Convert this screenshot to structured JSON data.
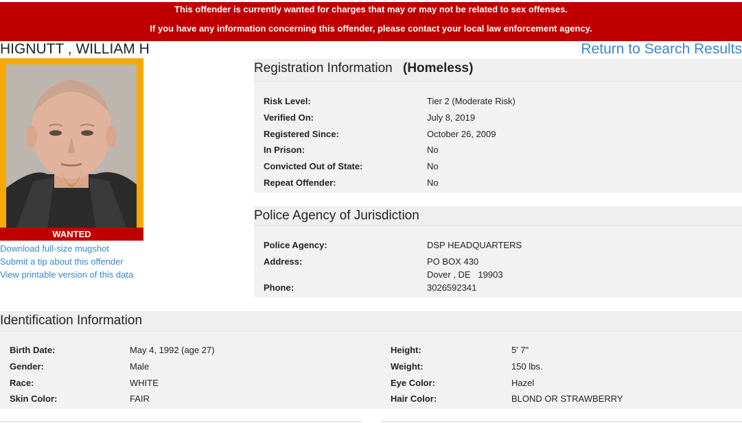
{
  "banner": {
    "line1": "This offender is currently wanted for charges that may or may not be related to sex offenses.",
    "line2": "If you have any information concerning this offender, please contact your local law enforcement agency."
  },
  "offender": {
    "name": "HIGNUTT , WILLIAM H"
  },
  "nav": {
    "return_label": "Return to Search Results"
  },
  "photo": {
    "badge": "WANTED",
    "frame_color": "#f7a800"
  },
  "links": [
    "Download full-size mugshot",
    "Submit a tip about this offender",
    "View printable version of this data"
  ],
  "registration": {
    "title": "Registration Information",
    "status": "(Homeless)",
    "rows": [
      {
        "label": "Risk Level:",
        "value": "Tier 2 (Moderate Risk)"
      },
      {
        "label": "Verified On:",
        "value": "July 8, 2019"
      },
      {
        "label": "Registered Since:",
        "value": "October 26, 2009"
      },
      {
        "label": "In Prison:",
        "value": "No"
      },
      {
        "label": "Convicted Out of State:",
        "value": "No"
      },
      {
        "label": "Repeat Offender:",
        "value": "No"
      }
    ]
  },
  "police": {
    "title": "Police Agency of Jurisdiction",
    "agency_label": "Police Agency:",
    "agency_value": "DSP HEADQUARTERS",
    "address_label": "Address:",
    "address_line1": "PO BOX 430",
    "address_line2": "Dover , DE   19903",
    "phone_label": "Phone:",
    "phone_value": "3026592341"
  },
  "identification": {
    "title": "Identification Information",
    "left": [
      {
        "label": "Birth Date:",
        "value": "May 4, 1992 (age 27)"
      },
      {
        "label": "Gender:",
        "value": "Male"
      },
      {
        "label": "Race:",
        "value": "WHITE"
      },
      {
        "label": "Skin Color:",
        "value": "FAIR"
      }
    ],
    "right": [
      {
        "label": "Height:",
        "value": "5' 7\""
      },
      {
        "label": "Weight:",
        "value": "150 lbs."
      },
      {
        "label": "Eye Color:",
        "value": "Hazel"
      },
      {
        "label": "Hair Color:",
        "value": "BLOND OR STRAWBERRY"
      }
    ]
  },
  "colors": {
    "banner": "#c00000",
    "link": "#3a87c9"
  }
}
